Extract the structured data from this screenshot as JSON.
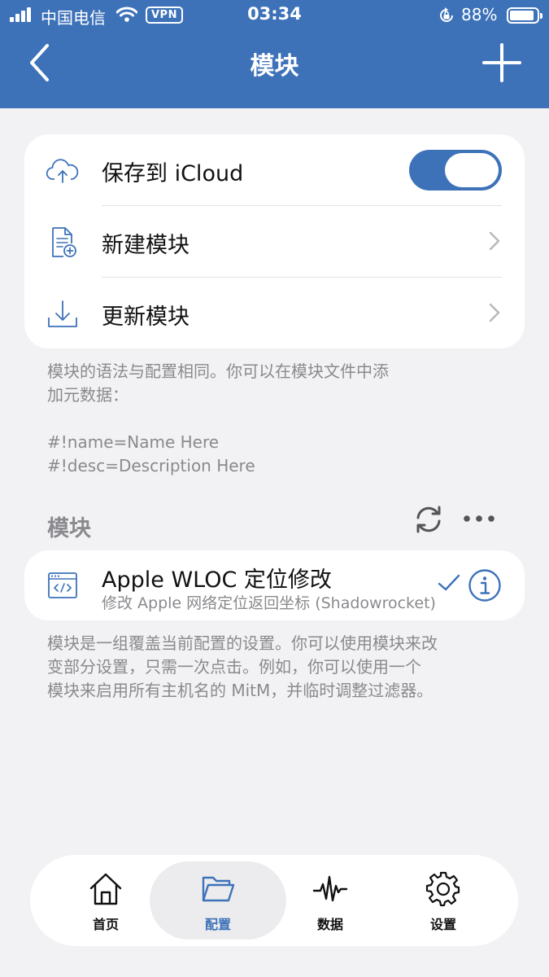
{
  "status_bar": {
    "carrier": "中国电信",
    "vpn_badge": "VPN",
    "time": "03:34",
    "battery_percent": "88%",
    "battery_level": 0.88,
    "icons": [
      "signal-icon",
      "wifi-icon",
      "rotation-lock-icon",
      "battery-icon"
    ]
  },
  "nav": {
    "title": "模块",
    "back_icon": "chevron-left-icon",
    "add_icon": "plus-icon"
  },
  "settings_card": {
    "items": [
      {
        "label": "保存到 iCloud",
        "icon": "cloud-upload-icon",
        "toggle_on": true
      },
      {
        "label": "新建模块",
        "icon": "new-document-icon"
      },
      {
        "label": "更新模块",
        "icon": "download-icon"
      }
    ]
  },
  "notes": {
    "syntax": "模块的语法与配置相同。你可以在模块文件中添\n加元数据：",
    "metadata_example": "#!name=Name Here\n#!desc=Description Here",
    "explanation": "模块是一组覆盖当前配置的设置。你可以使用模块来改\n变部分设置，只需一次点击。例如，你可以使用一个\n模块来启用所有主机名的 MitM，并临时调整过滤器。"
  },
  "modules_section": {
    "title": "模块",
    "actions": [
      "refresh-icon",
      "more-icon"
    ],
    "modules": [
      {
        "name": "Apple WLOC 定位修改",
        "description": "修改 Apple 网络定位返回坐标 (Shadowrocket)",
        "enabled": true,
        "icon": "code-window-icon"
      }
    ]
  },
  "tab_bar": {
    "tabs": [
      {
        "label": "首页",
        "icon": "home-icon",
        "active": false
      },
      {
        "label": "配置",
        "icon": "folder-icon",
        "active": true
      },
      {
        "label": "数据",
        "icon": "waveform-icon",
        "active": false
      },
      {
        "label": "设置",
        "icon": "gear-icon",
        "active": false
      }
    ]
  },
  "colors": {
    "accent": "#3d72b9",
    "background": "#f2f2f4",
    "secondary_text": "#8a8a8e"
  }
}
